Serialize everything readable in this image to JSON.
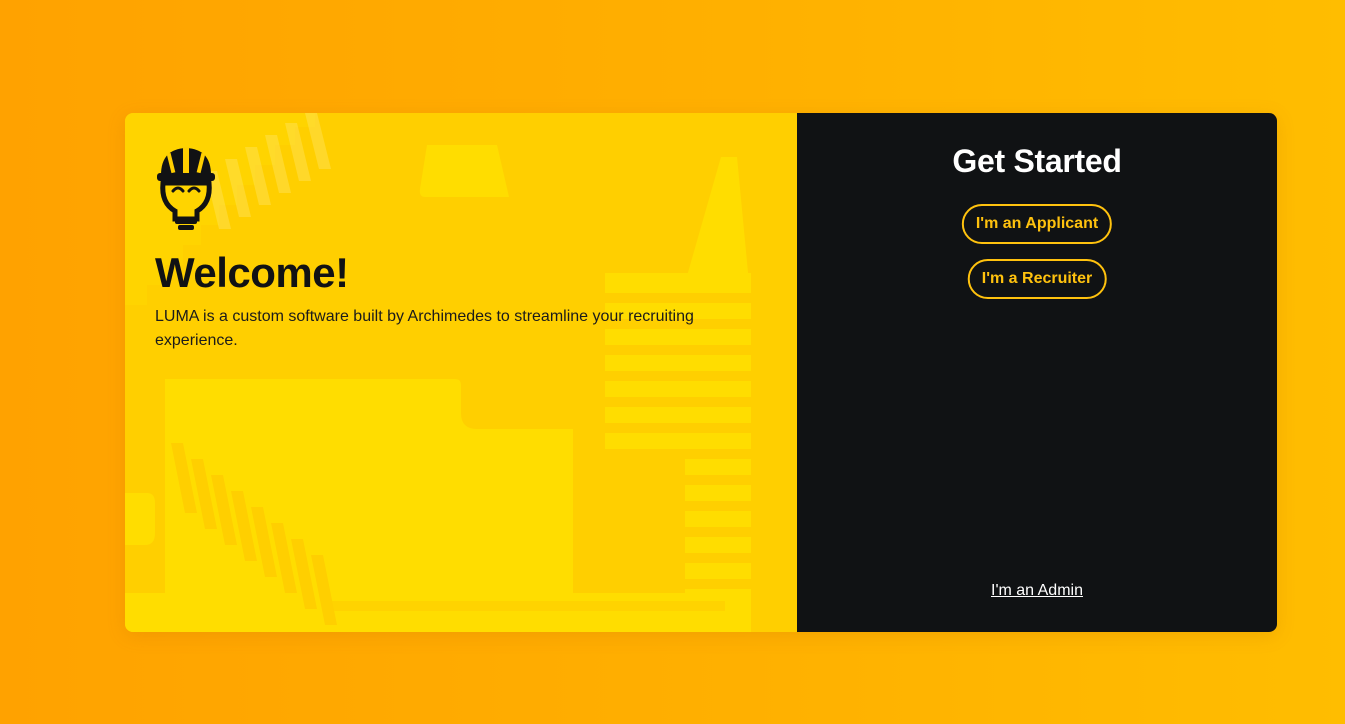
{
  "welcome": {
    "title": "Welcome!",
    "description": "LUMA is a custom software built by Archimedes to streamline your recruiting experience."
  },
  "get_started": {
    "title": "Get Started",
    "applicant_label": "I'm an Applicant",
    "recruiter_label": "I'm a Recruiter",
    "admin_label": "I'm an Admin"
  },
  "logo": {
    "icon": "lightbulb-hardhat-logo-icon"
  },
  "colors": {
    "background_gradient_start": "#ffa200",
    "background_gradient_end": "#ffbd00",
    "left_panel": "#ffcf00",
    "left_panel_art": "#ffe000",
    "right_panel": "#101214",
    "accent": "#ffc20e",
    "text_dark": "#111214",
    "text_light": "#ffffff"
  }
}
